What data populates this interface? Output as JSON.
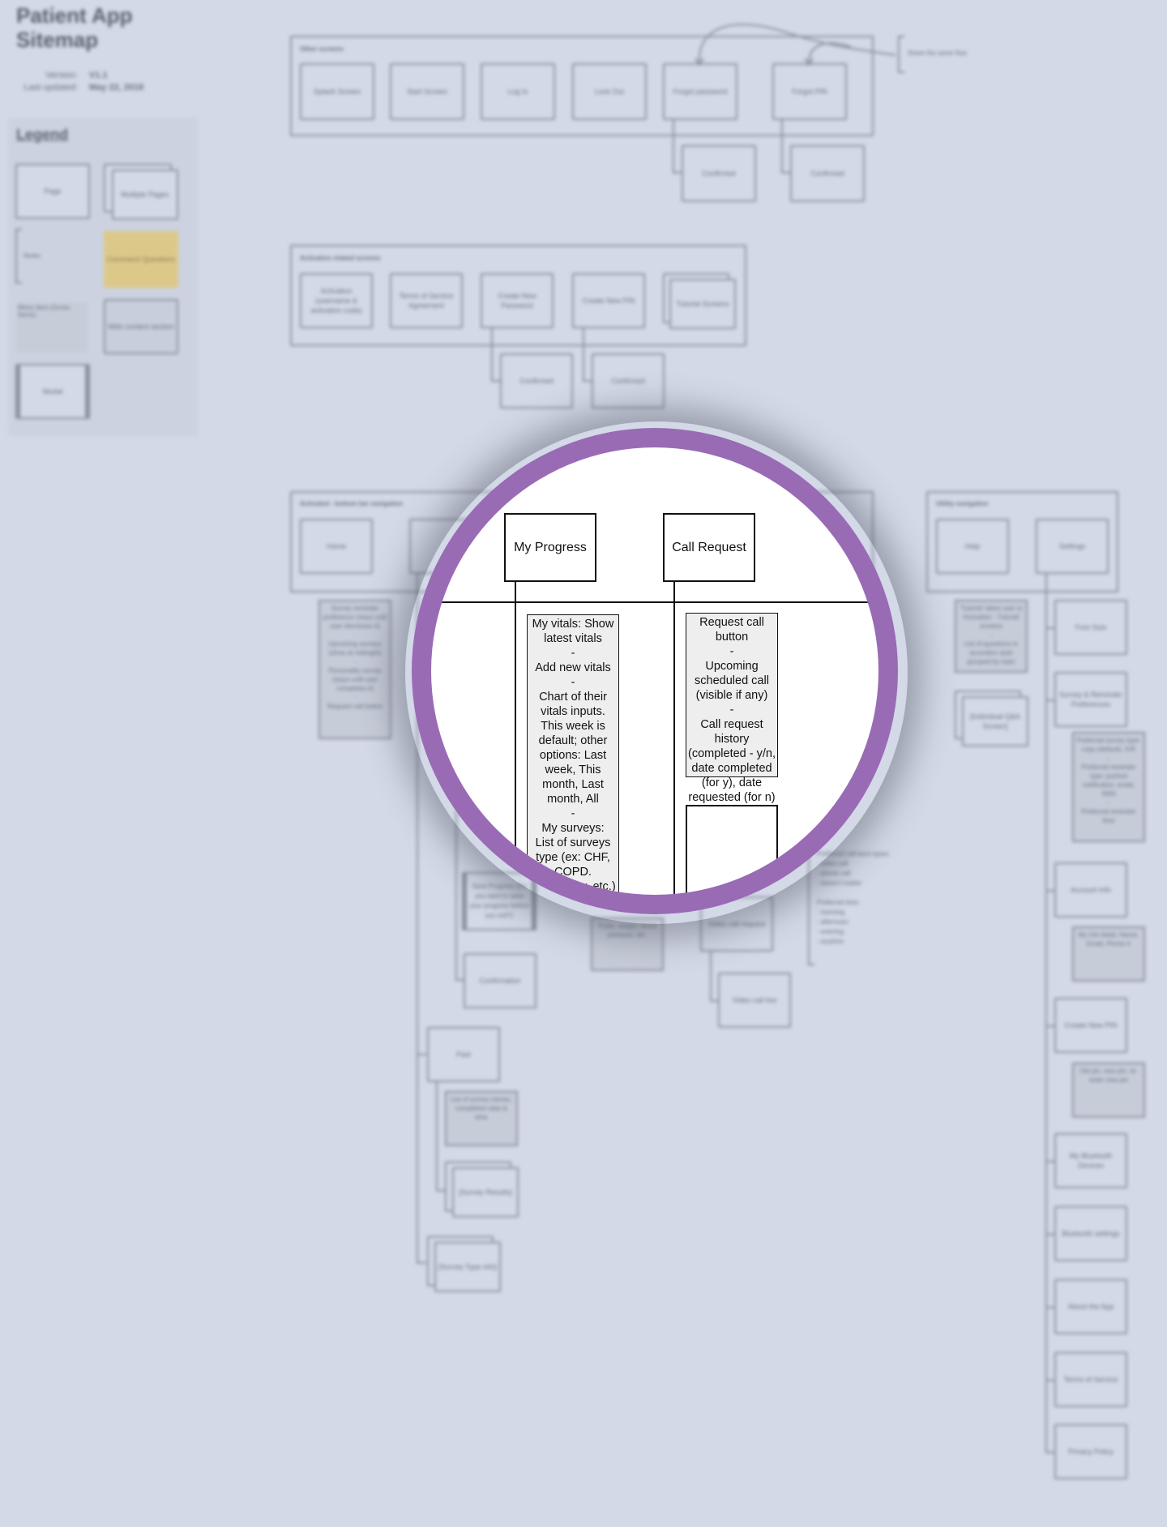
{
  "header": {
    "title": "Patient App Sitemap",
    "version_label": "Version:",
    "version_value": "V1.1",
    "updated_label": "Last updated:",
    "updated_value": "May 22, 2018"
  },
  "legend": {
    "title": "Legend",
    "items": {
      "page": "Page",
      "multiple_pages": "Multiple Pages",
      "notes": "Notes",
      "comment": "Comment/ Questions",
      "menu_item": "Menu Item (Gross Items)",
      "web_content": "Web content section",
      "modal": "Modal"
    }
  },
  "other_screens": {
    "label": "Other screens",
    "pages": [
      "Splash Screen",
      "Start Screen",
      "Log In",
      "Lock Out",
      "Forgot password",
      "Forgot PIN"
    ],
    "confirmed": [
      "Confirmed",
      "Confirmed"
    ],
    "side_note": "Share the same flow"
  },
  "activation": {
    "label": "Activation related screens",
    "pages": [
      "Activation (username & activation code)",
      "Terms of Service Agreement",
      "Create New Password",
      "Create New PIN",
      "Tutorial Screens"
    ],
    "confirmed": [
      "Confirmed",
      "Confirmed"
    ]
  },
  "bottom_nav": {
    "label": "Activated - bottom bar navigation",
    "home": "Home",
    "home_note": "Survey reminder preference (stays until user dismisses it)\n-\nUpcoming surveys (show at midnight)\n-\nPersonality survey (stays until user completes it)\n-\nRequest call button",
    "save_progress": "Save Progress (Do you want to save your progress before you exit?)",
    "confirmation": "Confirmation",
    "vitals_note": "Pulse, weight, blood pressure, etc.",
    "video_call_request": "Video call request",
    "video_call_live": "Video call live",
    "past": "Past",
    "past_note": "List of survey names, completion date & time",
    "survey_results": "[Survey Results]",
    "survey_type_info": "[Survey Type info]",
    "call_notes": "Preferred call back types:\n- video call\n- phone call\n- doesn't matter\n\nPreferred time:\n- morning\n- afternoon\n- evening\n- anytime"
  },
  "utility_nav": {
    "label": "Utility navigation",
    "help": "Help",
    "settings": "Settings",
    "help_note": "'Tutorial' takes user to 'Activation - Tutorial' screens\n-\nList of questions in accordion style grouped by topic",
    "qa_screen": "[Individual Q&A Screen]",
    "settings_items": [
      "Font Size",
      "Survey & Reminder Preferences",
      "Account Info",
      "Create New PIN",
      "My Bluetooth Devices",
      "Bluetooth settings",
      "About the App",
      "Terms of Service",
      "Privacy Policy"
    ],
    "survey_pref_note": "Preferred survey type: copy (default), IVR\n-\nPreferred reminder type: pushed notification, email, SMS\n-\nPreferred reminder time",
    "account_note": "My info fields: Name, Email, Phone #",
    "pin_note": "Old pin, new pin, re-enter new pin"
  },
  "magnifier": {
    "my_progress": "My Progress",
    "call_request": "Call Request",
    "progress_note": "My vitals: Show latest vitals\n-\nAdd new vitals\n-\nChart of their vitals inputs. This week is default; other options: Last week, This month, Last month, All\n-\nMy surveys:\nList of surveys type (ex: CHF, COPD. personality, etc.) - links back to \"My Surveys\" tab with",
    "call_note": "Request call button\n-\nUpcoming scheduled call (visible if any)\n-\nCall request history (completed - y/n, date completed (for y), date requested (for n)",
    "ring_color": "#996bb5"
  }
}
